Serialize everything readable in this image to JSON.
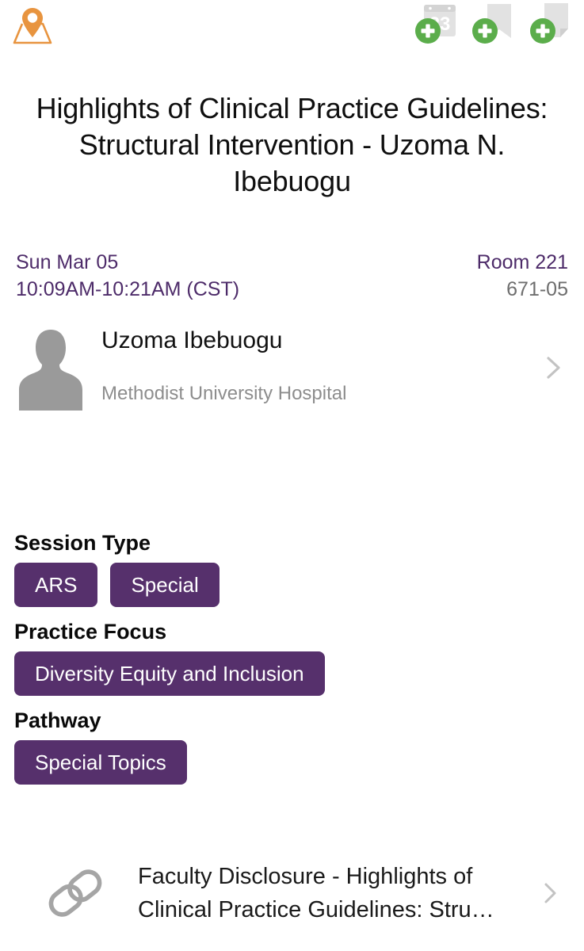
{
  "header": {
    "brand_icon": "map-pin-icon",
    "actions": [
      {
        "icon": "add-to-calendar-icon",
        "badge": "+",
        "calendar_day": "23"
      },
      {
        "icon": "add-bookmark-icon",
        "badge": "+"
      },
      {
        "icon": "add-note-icon",
        "badge": "+"
      }
    ]
  },
  "session": {
    "title": "Highlights of Clinical Practice Guidelines: Structural Intervention - Uzoma N. Ibebuogu",
    "date": "Sun Mar 05",
    "time": "10:09AM-10:21AM (CST)",
    "room": "Room 221",
    "session_code": "671-05"
  },
  "speaker": {
    "name": "Uzoma Ibebuogu",
    "organization": "Methodist University Hospital",
    "avatar_icon": "person-placeholder-icon",
    "chevron_icon": "chevron-right-icon"
  },
  "tag_sections": [
    {
      "heading": "Session Type",
      "tags": [
        "ARS",
        "Special"
      ]
    },
    {
      "heading": "Practice Focus",
      "tags": [
        "Diversity Equity and Inclusion"
      ]
    },
    {
      "heading": "Pathway",
      "tags": [
        "Special Topics"
      ]
    }
  ],
  "disclosure": {
    "icon": "link-chain-icon",
    "text": "Faculty Disclosure - Highlights of Clinical Practice Guidelines: Stru…",
    "chevron_icon": "chevron-right-icon"
  },
  "colors": {
    "brand_orange": "#e8943f",
    "accent_purple": "#56306c",
    "meta_purple": "#4d2b69",
    "badge_green": "#5bad4b",
    "placeholder_gray": "#9a9a9a",
    "icon_gray": "#e2e2e2"
  }
}
